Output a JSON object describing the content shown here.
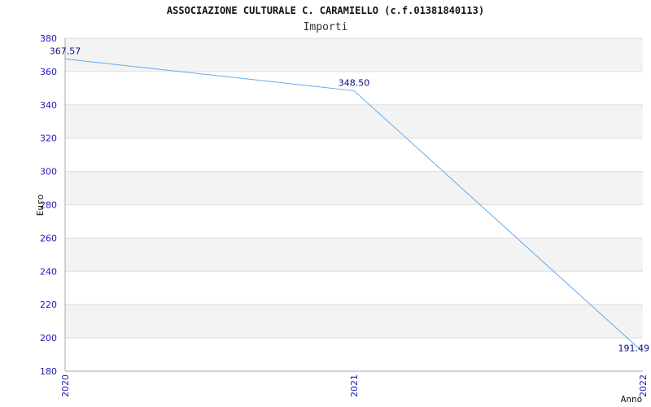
{
  "chart_data": {
    "type": "line",
    "title": "ASSOCIAZIONE CULTURALE C. CARAMIELLO (c.f.01381840113)",
    "subtitle": "Importi",
    "xlabel": "Anno",
    "ylabel": "Euro",
    "categories": [
      "2020",
      "2021",
      "2022"
    ],
    "values": [
      367.57,
      348.5,
      191.49
    ],
    "value_labels": [
      "367.57",
      "348.50",
      "191.49"
    ],
    "ylim": [
      180,
      380
    ],
    "yticks": [
      180,
      200,
      220,
      240,
      260,
      280,
      300,
      320,
      340,
      360,
      380
    ],
    "grid": true,
    "line_color": "#66aaee",
    "band_color": "#f3f3f3",
    "tick_color": "#1a1ab8"
  }
}
